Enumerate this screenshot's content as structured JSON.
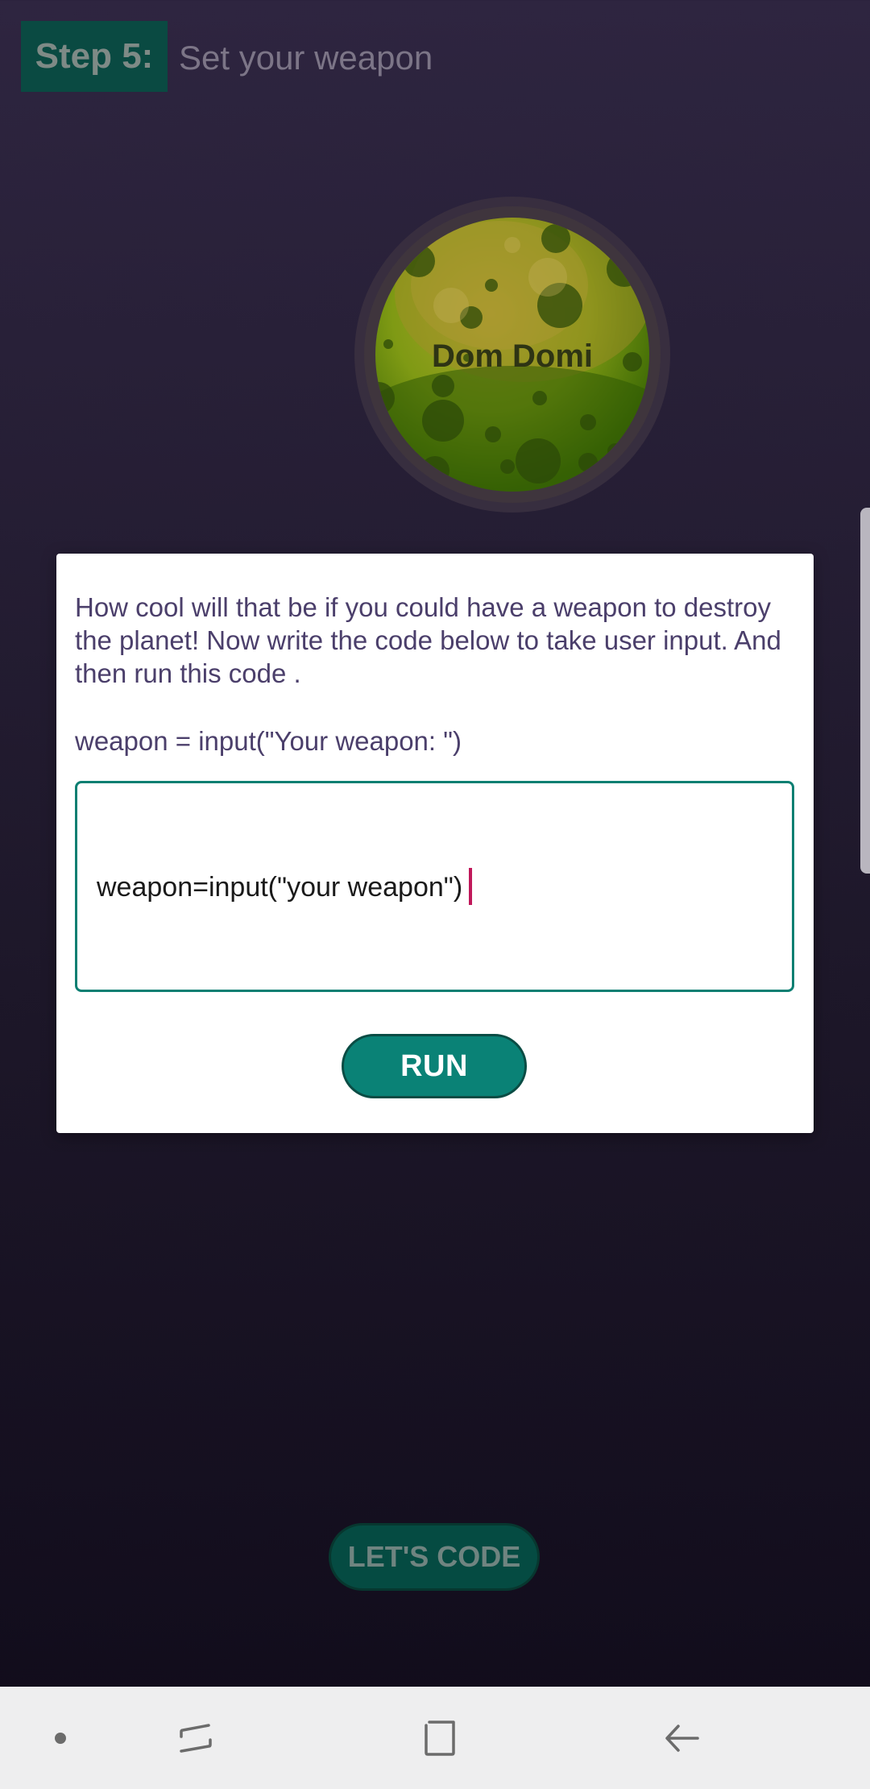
{
  "header": {
    "step_label": "Step 5:",
    "title": "Set your weapon"
  },
  "planet": {
    "name": "Dom Domi"
  },
  "dialog": {
    "description": "How cool will that be if you could have a weapon to destroy the planet! Now write the code below to take user input. And then run this code .",
    "example_code": "weapon = input(\"Your weapon: \")",
    "input_value": "weapon=input(\"your weapon\")",
    "run_label": "RUN"
  },
  "footer": {
    "lets_code_label": "LET'S CODE"
  },
  "navbar": {
    "items": [
      {
        "icon": "dot-icon"
      },
      {
        "icon": "recent-apps-icon"
      },
      {
        "icon": "home-icon"
      },
      {
        "icon": "back-icon"
      }
    ]
  },
  "colors": {
    "accent": "#0a8276",
    "caret": "#c0185a",
    "dialog_text": "#4b3f6b",
    "background_top": "#2e2540",
    "background_bottom": "#100b1a"
  }
}
